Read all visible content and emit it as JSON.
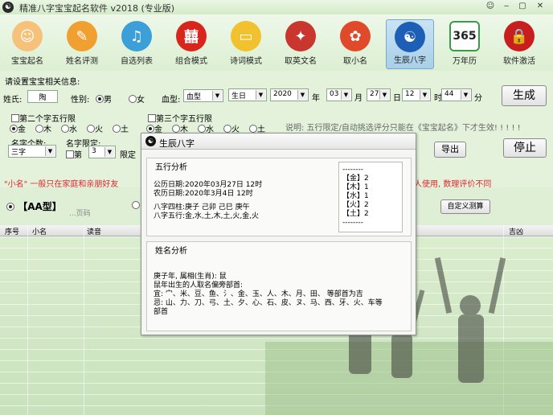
{
  "window": {
    "title": "精准八字宝宝起名软件 v2018 (专业版)",
    "minimize": "▢",
    "close": "✕",
    "help": "☺"
  },
  "toolbar": [
    {
      "label": "宝宝起名",
      "icon": "baby-face-icon",
      "color": "#f6c27a",
      "glyph": "☺"
    },
    {
      "label": "姓名评测",
      "icon": "paper-crane-icon",
      "color": "#f0a030",
      "glyph": "✎"
    },
    {
      "label": "自选列表",
      "icon": "bird-icon",
      "color": "#3c9fd8",
      "glyph": "♫"
    },
    {
      "label": "组合模式",
      "icon": "lantern-icon",
      "color": "#d9261c",
      "glyph": "囍"
    },
    {
      "label": "诗词模式",
      "icon": "book-icon",
      "color": "#f2c12e",
      "glyph": "▭"
    },
    {
      "label": "取英文名",
      "icon": "eagle-icon",
      "color": "#c8362e",
      "glyph": "✦"
    },
    {
      "label": "取小名",
      "icon": "flower-icon",
      "color": "#e04a2a",
      "glyph": "✿"
    },
    {
      "label": "生辰八字",
      "icon": "yin-yang-icon",
      "color": "#1d5fb7",
      "glyph": "☯"
    },
    {
      "label": "万年历",
      "icon": "calendar-365-icon",
      "color": "#3d9b47",
      "glyph": "365"
    },
    {
      "label": "软件激活",
      "icon": "lock-icon",
      "color": "#c81e1e",
      "glyph": "🔒"
    }
  ],
  "form": {
    "prompt": "请设置宝宝相关信息:",
    "surname_label": "姓氏:",
    "surname_value": "陶",
    "gender_label": "性别:",
    "male": "男",
    "female": "女",
    "blood_label": "血型:",
    "blood_value": "血型",
    "calendar_value": "生日",
    "year_value": "2020",
    "year_unit": "年",
    "month_value": "03",
    "month_unit": "月",
    "day_value": "27",
    "day_unit": "日",
    "hour_value": "12",
    "hour_unit": "时",
    "minute_value": "44",
    "minute_unit": "分",
    "generate": "生成",
    "second_limit_label": "第二个字五行限",
    "third_limit_label": "第三个字五行限",
    "elements": [
      "金",
      "木",
      "水",
      "火",
      "土"
    ],
    "note": "说明: 五行限定/自动挑选评分只能在《宝宝起名》下才生效! ! ! ! !",
    "name_count_label": "名字个数:",
    "name_count_value": "三字",
    "name_limit_label": "名字限定:",
    "name_limit_chk": "第",
    "name_limit_pos": "3",
    "name_limit_word": "限定",
    "export": "导出",
    "stop": "停止"
  },
  "banner": {
    "left": "\"小名\" 一般只在家庭和亲朋好友",
    "right": "人使用, 数理评价不同"
  },
  "type_row": {
    "aa": "【AA型】",
    "page": "...页码",
    "custom": "自定义测算"
  },
  "grid": {
    "headers": [
      "序号",
      "小名",
      "读音",
      "吉凶"
    ]
  },
  "dialog": {
    "title": "生辰八字",
    "wuxing_title": "五行分析",
    "solar": "公历日期:2020年03月27日 12时",
    "lunar": "农历日期:2020年3月4日 12时",
    "bazi": "八字四柱:庚子 己卯 己巳 庚午",
    "wuxing": "八字五行:金,水,土,木,土,火,金,火",
    "counts": [
      "--------",
      "【金】2",
      "【木】1",
      "【水】1",
      "【火】2",
      "【土】2",
      "--------"
    ],
    "name_title": "姓名分析",
    "name_lines": [
      "庚子年, 属相(生肖): 鼠",
      "鼠年出生的人取名偏旁部首:",
      "宜: 宀、米、豆、鱼、氵、金、玉、人、木、月、田、 等部首为吉",
      "忌: 山、力、刀、弓、土、夕、心、石、皮、ヌ、马、西、牙、火、车等",
      "部首"
    ]
  }
}
